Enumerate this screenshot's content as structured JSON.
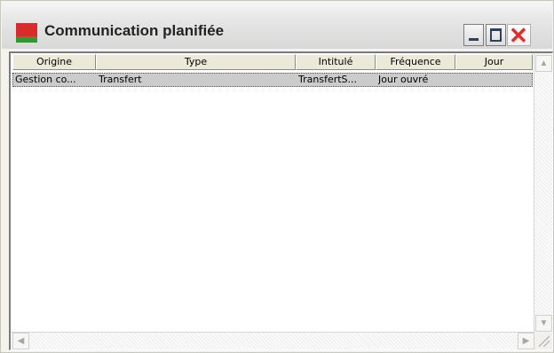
{
  "window": {
    "title": "Communication planifiée",
    "icon": "app-icon"
  },
  "titlebar_buttons": {
    "minimize_icon": "minimize-icon",
    "maximize_icon": "maximize-icon",
    "close_icon": "close-icon"
  },
  "table": {
    "columns": [
      "Origine",
      "Type",
      "Intitulé",
      "Fréquence",
      "Jour"
    ],
    "rows": [
      [
        "Gestion co...",
        "Transfert",
        "TransfertS...",
        "Jour ouvré",
        ""
      ]
    ]
  },
  "scrollbar": {
    "up_arrow": "▲",
    "down_arrow": "▼",
    "left_arrow": "◀",
    "right_arrow": "▶"
  },
  "colors": {
    "icon_red": "#d82b2b",
    "icon_green": "#2f9a2f",
    "close_red": "#e12c2c",
    "selected_row": "#cbcbcb"
  }
}
